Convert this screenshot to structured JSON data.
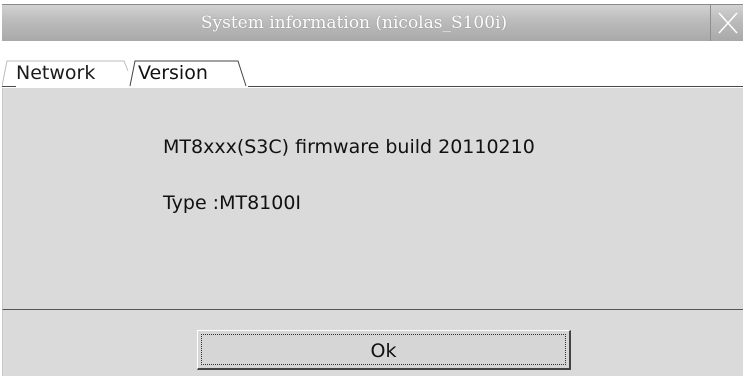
{
  "window": {
    "title": "System information (nicolas_S100i)"
  },
  "tabs": [
    {
      "label": "Network",
      "active": false
    },
    {
      "label": "Version",
      "active": true
    }
  ],
  "version_panel": {
    "firmware_line": "MT8xxx(S3C) firmware build 20110210",
    "type_line": "Type :MT8100I"
  },
  "footer": {
    "ok_label": "Ok"
  },
  "icons": {
    "close": "close-icon"
  },
  "colors": {
    "titlebar": "#b4b4b4",
    "panel": "#dadada",
    "title_text": "#ffffff"
  }
}
